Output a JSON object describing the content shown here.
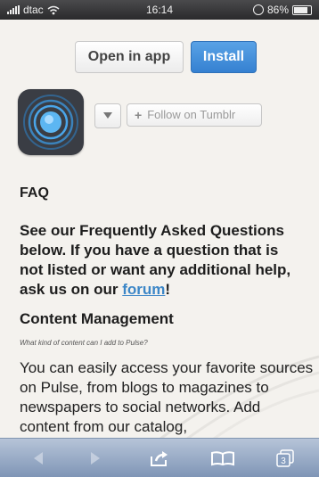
{
  "status": {
    "carrier": "dtac",
    "time": "16:14",
    "battery": "86%"
  },
  "banner": {
    "open_label": "Open in app",
    "install_label": "Install"
  },
  "header": {
    "follow_plus": "+",
    "follow_label": "Follow on Tumblr"
  },
  "content": {
    "faq_title": "FAQ",
    "intro_text": "See our Frequently Asked Questions below. If you have a question that is not listed or want any additional help, ask us on our ",
    "intro_link": "forum",
    "intro_end": "!",
    "section_title": "Content Management",
    "question": "What kind of content can I add to Pulse?",
    "body_text": "You can easily access your favorite sources on Pulse, from blogs to magazines to newspapers to social networks. Add content from our catalog,"
  },
  "toolbar": {
    "tabs_count": "3"
  },
  "icons": [
    "signal-bars-icon",
    "wifi-icon",
    "orientation-lock-icon",
    "battery-icon",
    "dropdown-arrow-icon",
    "back-arrow-icon",
    "forward-arrow-icon",
    "share-icon",
    "bookmarks-icon",
    "tabs-icon"
  ],
  "colors": {
    "install_blue": "#3581d1",
    "link_blue": "#3b86c7",
    "toolbar": "#9aaeca"
  }
}
